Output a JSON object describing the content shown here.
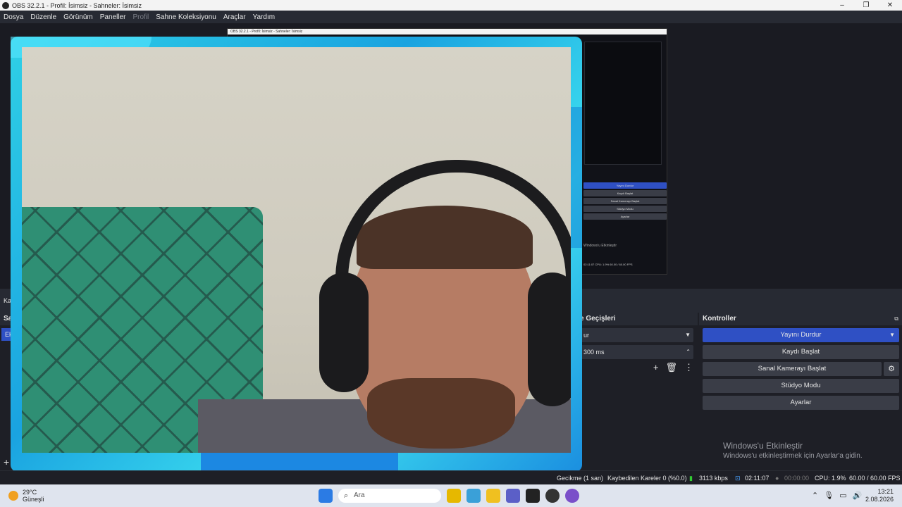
{
  "window": {
    "title": "OBS 32.2.1 - Profil: İsimsiz - Sahneler: İsimsiz",
    "controls": [
      "–",
      "❐",
      "✕"
    ]
  },
  "menu": [
    "Dosya",
    "Düzenle",
    "Görünüm",
    "Paneller",
    "Profil",
    "Sahne Koleksiyonu",
    "Araçlar",
    "Yardım"
  ],
  "nested_preview": {
    "title": "OBS 32.2.1 - Profil: İsimsiz - Sahneler: İsimsiz",
    "buttons": [
      "Yayını Durdur",
      "Kaydı Başlat",
      "Sanal Kamerayı Başlat",
      "Stüdyo Modu",
      "Ayarlar"
    ],
    "activate": "Windows'u Etkinleştir",
    "status": "02:11:07   CPU: 1.9%   60.00 / 60.00 FPS"
  },
  "docks": {
    "scenes_title": "Sa",
    "scenes_active": "Ek",
    "mixer_title": "Ka",
    "transitions_title": "e Geçişleri",
    "transition_value": "ur",
    "duration": "300 ms",
    "controls_title": "Kontroller"
  },
  "controls": {
    "stream": "Yayını Durdur",
    "record": "Kaydı Başlat",
    "virtualcam": "Sanal Kamerayı Başlat",
    "studio": "Stüdyo Modu",
    "settings": "Ayarlar"
  },
  "activate": {
    "line1": "Windows'u Etkinleştir",
    "line2": "Windows'u etkinleştirmek için Ayarlar'a gidin."
  },
  "status": {
    "delay": "Gecikme (1 san)",
    "dropped": "Kaybedilen Kareler 0 (%0.0)",
    "bitrate": "3113 kbps",
    "stream_time": "02:11:07",
    "record_time": "00:00:00",
    "cpu": "CPU: 1.9%",
    "fps": "60.00 / 60.00 FPS"
  },
  "taskbar": {
    "temp": "29°C",
    "weather": "Güneşli",
    "search_placeholder": "Ara",
    "time": "13:21",
    "date": "2.08.2026"
  }
}
